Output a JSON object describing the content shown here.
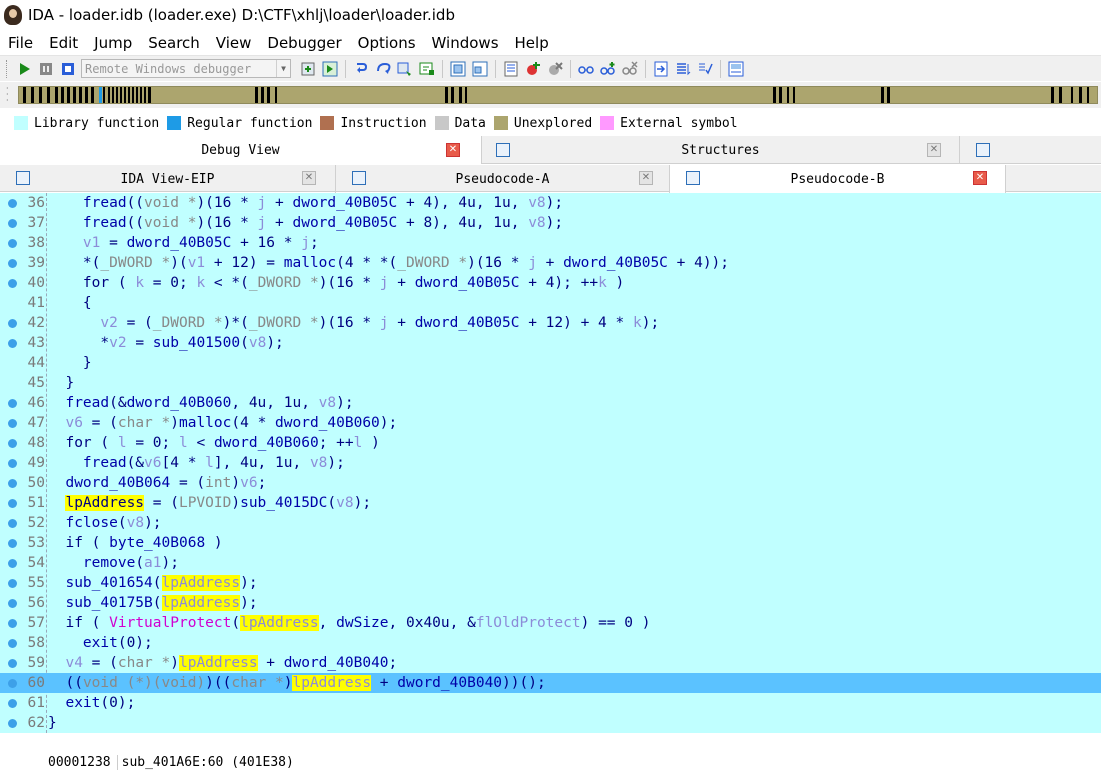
{
  "window": {
    "title": "IDA - loader.idb (loader.exe) D:\\CTF\\xhlj\\loader\\loader.idb"
  },
  "menu": [
    "File",
    "Edit",
    "Jump",
    "Search",
    "View",
    "Debugger",
    "Options",
    "Windows",
    "Help"
  ],
  "toolbar": {
    "debugger_select": "Remote Windows debugger"
  },
  "legend": [
    {
      "label": "Library function",
      "color": "#c0ffff"
    },
    {
      "label": "Regular function",
      "color": "#1e9be6"
    },
    {
      "label": "Instruction",
      "color": "#b07050"
    },
    {
      "label": "Data",
      "color": "#c8c8c8"
    },
    {
      "label": "Unexplored",
      "color": "#aca56e"
    },
    {
      "label": "External symbol",
      "color": "#ff99ff"
    }
  ],
  "tabs_top": [
    {
      "label": "Debug View",
      "close": "red"
    },
    {
      "label": "Structures",
      "close": "grey"
    }
  ],
  "tabs_bottom": [
    {
      "label": "IDA View-EIP",
      "close": "grey"
    },
    {
      "label": "Pseudocode-A",
      "close": "grey"
    },
    {
      "label": "Pseudocode-B",
      "close": "red"
    }
  ],
  "code": [
    {
      "n": "36",
      "dot": true,
      "indent": "    ",
      "segs": [
        [
          "fn",
          "fread"
        ],
        [
          "",
          "(("
        ],
        [
          "typ",
          "void *"
        ],
        [
          "",
          ")(16 * "
        ],
        [
          "var",
          "j"
        ],
        [
          "",
          ""
        ],
        [
          "",
          " + "
        ],
        [
          "fn",
          "dword_40B05C"
        ],
        [
          "",
          " + 4), 4u, 1u, "
        ],
        [
          "var",
          "v8"
        ],
        [
          "",
          ");"
        ]
      ]
    },
    {
      "n": "37",
      "dot": true,
      "indent": "    ",
      "segs": [
        [
          "fn",
          "fread"
        ],
        [
          "",
          "(("
        ],
        [
          "typ",
          "void *"
        ],
        [
          "",
          ")(16 * "
        ],
        [
          "var",
          "j"
        ],
        [
          "",
          " + "
        ],
        [
          "fn",
          "dword_40B05C"
        ],
        [
          "",
          " + 8), 4u, 1u, "
        ],
        [
          "var",
          "v8"
        ],
        [
          "",
          ");"
        ]
      ]
    },
    {
      "n": "38",
      "dot": true,
      "indent": "    ",
      "segs": [
        [
          "var",
          "v1"
        ],
        [
          "",
          " = "
        ],
        [
          "fn",
          "dword_40B05C"
        ],
        [
          "",
          " + 16 * "
        ],
        [
          "var",
          "j"
        ],
        [
          "",
          ";"
        ]
      ]
    },
    {
      "n": "39",
      "dot": true,
      "indent": "    ",
      "segs": [
        [
          "",
          "*("
        ],
        [
          "typ",
          "_DWORD *"
        ],
        [
          "",
          ")("
        ],
        [
          "var",
          "v1"
        ],
        [
          "",
          " + 12) = "
        ],
        [
          "fn",
          "malloc"
        ],
        [
          "",
          "(4 * *("
        ],
        [
          "typ",
          "_DWORD *"
        ],
        [
          "",
          ")(16 * "
        ],
        [
          "var",
          "j"
        ],
        [
          "",
          " + "
        ],
        [
          "fn",
          "dword_40B05C"
        ],
        [
          "",
          " + 4));"
        ]
      ]
    },
    {
      "n": "40",
      "dot": true,
      "indent": "    ",
      "segs": [
        [
          "kw",
          "for"
        ],
        [
          "",
          " ( "
        ],
        [
          "var",
          "k"
        ],
        [
          "",
          " = 0; "
        ],
        [
          "var",
          "k"
        ],
        [
          "",
          " < *("
        ],
        [
          "typ",
          "_DWORD *"
        ],
        [
          "",
          ")(16 * "
        ],
        [
          "var",
          "j"
        ],
        [
          "",
          " + "
        ],
        [
          "fn",
          "dword_40B05C"
        ],
        [
          "",
          " + 4); ++"
        ],
        [
          "var",
          "k"
        ],
        [
          "",
          " )"
        ]
      ]
    },
    {
      "n": "41",
      "dot": false,
      "indent": "    ",
      "segs": [
        [
          "",
          "{"
        ]
      ]
    },
    {
      "n": "42",
      "dot": true,
      "indent": "      ",
      "segs": [
        [
          "var",
          "v2"
        ],
        [
          "",
          " = ("
        ],
        [
          "typ",
          "_DWORD *"
        ],
        [
          "",
          ")*("
        ],
        [
          "typ",
          "_DWORD *"
        ],
        [
          "",
          ")(16 * "
        ],
        [
          "var",
          "j"
        ],
        [
          "",
          " + "
        ],
        [
          "fn",
          "dword_40B05C"
        ],
        [
          "",
          " + 12) + 4 * "
        ],
        [
          "var",
          "k"
        ],
        [
          "",
          ");"
        ]
      ]
    },
    {
      "n": "43",
      "dot": true,
      "indent": "      ",
      "segs": [
        [
          "",
          "*"
        ],
        [
          "var",
          "v2"
        ],
        [
          "",
          " = "
        ],
        [
          "fn",
          "sub_401500"
        ],
        [
          "",
          "("
        ],
        [
          "var",
          "v8"
        ],
        [
          "",
          ");"
        ]
      ]
    },
    {
      "n": "44",
      "dot": false,
      "indent": "    ",
      "segs": [
        [
          "",
          "}"
        ]
      ]
    },
    {
      "n": "45",
      "dot": false,
      "indent": "  ",
      "segs": [
        [
          "",
          "}"
        ]
      ]
    },
    {
      "n": "46",
      "dot": true,
      "indent": "  ",
      "segs": [
        [
          "fn",
          "fread"
        ],
        [
          "",
          "(&"
        ],
        [
          "fn",
          "dword_40B060"
        ],
        [
          "",
          ", 4u, 1u, "
        ],
        [
          "var",
          "v8"
        ],
        [
          "",
          ");"
        ]
      ]
    },
    {
      "n": "47",
      "dot": true,
      "indent": "  ",
      "segs": [
        [
          "var",
          "v6"
        ],
        [
          "",
          " = ("
        ],
        [
          "typ",
          "char *"
        ],
        [
          "",
          ")"
        ],
        [
          "fn",
          "malloc"
        ],
        [
          "",
          "(4 * "
        ],
        [
          "fn",
          "dword_40B060"
        ],
        [
          "",
          ");"
        ]
      ]
    },
    {
      "n": "48",
      "dot": true,
      "indent": "  ",
      "segs": [
        [
          "kw",
          "for"
        ],
        [
          "",
          " ( "
        ],
        [
          "var",
          "l"
        ],
        [
          "",
          " = 0; "
        ],
        [
          "var",
          "l"
        ],
        [
          "",
          " < "
        ],
        [
          "fn",
          "dword_40B060"
        ],
        [
          "",
          "; ++"
        ],
        [
          "var",
          "l"
        ],
        [
          "",
          " )"
        ]
      ]
    },
    {
      "n": "49",
      "dot": true,
      "indent": "    ",
      "segs": [
        [
          "fn",
          "fread"
        ],
        [
          "",
          "(&"
        ],
        [
          "var",
          "v6"
        ],
        [
          "",
          "[4 * "
        ],
        [
          "var",
          "l"
        ],
        [
          "",
          "], 4u, 1u, "
        ],
        [
          "var",
          "v8"
        ],
        [
          "",
          ");"
        ]
      ]
    },
    {
      "n": "50",
      "dot": true,
      "indent": "  ",
      "segs": [
        [
          "fn",
          "dword_40B064"
        ],
        [
          "",
          " = ("
        ],
        [
          "typ",
          "int"
        ],
        [
          "",
          ")"
        ],
        [
          "var",
          "v6"
        ],
        [
          "",
          ";"
        ]
      ]
    },
    {
      "n": "51",
      "dot": true,
      "indent": "  ",
      "segs": [
        [
          "hy",
          "lpAddress"
        ],
        [
          "",
          " = ("
        ],
        [
          "typ",
          "LPVOID"
        ],
        [
          "",
          ")"
        ],
        [
          "fn",
          "sub_4015DC"
        ],
        [
          "",
          "("
        ],
        [
          "var",
          "v8"
        ],
        [
          "",
          ");"
        ]
      ]
    },
    {
      "n": "52",
      "dot": true,
      "indent": "  ",
      "segs": [
        [
          "fn",
          "fclose"
        ],
        [
          "",
          "("
        ],
        [
          "var",
          "v8"
        ],
        [
          "",
          ");"
        ]
      ]
    },
    {
      "n": "53",
      "dot": true,
      "indent": "  ",
      "segs": [
        [
          "kw",
          "if"
        ],
        [
          "",
          " ( "
        ],
        [
          "fn",
          "byte_40B068"
        ],
        [
          "",
          " )"
        ]
      ]
    },
    {
      "n": "54",
      "dot": true,
      "indent": "    ",
      "segs": [
        [
          "fn",
          "remove"
        ],
        [
          "",
          "("
        ],
        [
          "var",
          "a1"
        ],
        [
          "",
          ");"
        ]
      ]
    },
    {
      "n": "55",
      "dot": true,
      "indent": "  ",
      "segs": [
        [
          "fn",
          "sub_401654"
        ],
        [
          "",
          "("
        ],
        [
          "hyv",
          "lpAddress"
        ],
        [
          "",
          ");"
        ]
      ]
    },
    {
      "n": "56",
      "dot": true,
      "indent": "  ",
      "segs": [
        [
          "fn",
          "sub_40175B"
        ],
        [
          "",
          "("
        ],
        [
          "hyv",
          "lpAddress"
        ],
        [
          "",
          ");"
        ]
      ]
    },
    {
      "n": "57",
      "dot": true,
      "indent": "  ",
      "segs": [
        [
          "kw",
          "if"
        ],
        [
          "",
          " ( "
        ],
        [
          "api",
          "VirtualProtect"
        ],
        [
          "",
          "("
        ],
        [
          "hyv",
          "lpAddress"
        ],
        [
          "",
          ", "
        ],
        [
          "fn",
          "dwSize"
        ],
        [
          "",
          ", 0x40u, &"
        ],
        [
          "var",
          "flOldProtect"
        ],
        [
          "",
          ") == 0 )"
        ]
      ]
    },
    {
      "n": "58",
      "dot": true,
      "indent": "    ",
      "segs": [
        [
          "fn",
          "exit"
        ],
        [
          "",
          "(0);"
        ]
      ]
    },
    {
      "n": "59",
      "dot": true,
      "indent": "  ",
      "segs": [
        [
          "var",
          "v4"
        ],
        [
          "",
          " = ("
        ],
        [
          "typ",
          "char *"
        ],
        [
          "",
          ")"
        ],
        [
          "hyv",
          "lpAddress"
        ],
        [
          "",
          " + "
        ],
        [
          "fn",
          "dword_40B040"
        ],
        [
          "",
          ";"
        ]
      ]
    },
    {
      "n": "60",
      "dot": true,
      "hl": true,
      "indent": "  ",
      "segs": [
        [
          "",
          "(("
        ],
        [
          "typ",
          "void (*)(void)"
        ],
        [
          "",
          ")(("
        ],
        [
          "typ",
          "char *"
        ],
        [
          "",
          ")"
        ],
        [
          "hyv",
          "lpAddress"
        ],
        [
          "",
          " + "
        ],
        [
          "fn",
          "dword_40B040"
        ],
        [
          "",
          "))();"
        ]
      ]
    },
    {
      "n": "61",
      "dot": true,
      "indent": "  ",
      "segs": [
        [
          "fn",
          "exit"
        ],
        [
          "",
          "(0);"
        ]
      ]
    },
    {
      "n": "62",
      "dot": true,
      "indent": "",
      "segs": [
        [
          "",
          "}"
        ]
      ]
    }
  ],
  "status": {
    "offset": "00001238",
    "location": "sub_401A6E:60 (401E38)"
  }
}
